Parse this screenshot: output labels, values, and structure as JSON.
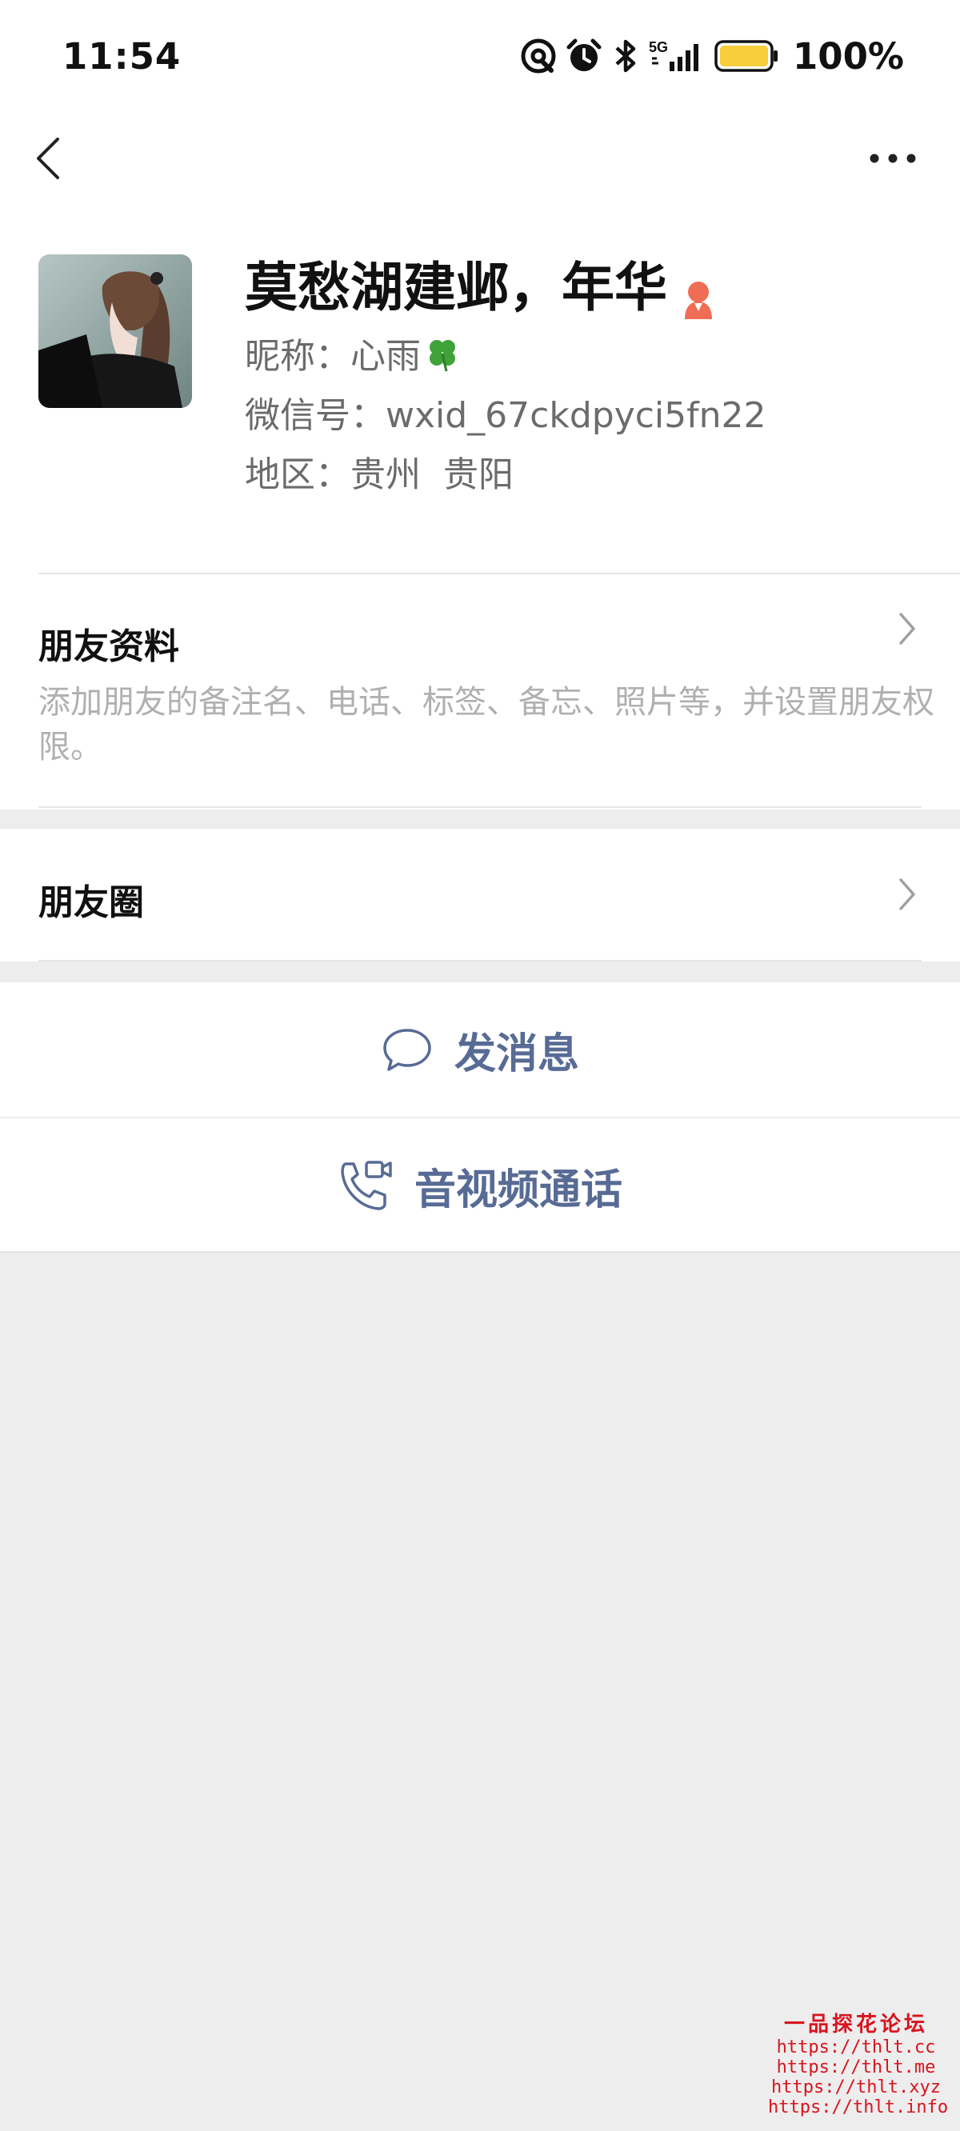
{
  "status_bar": {
    "time": "11:54",
    "network": "5G",
    "battery_percent": "100%",
    "icons": [
      "hotspot-icon",
      "alarm-icon",
      "bluetooth-icon",
      "signal-icon",
      "battery-icon"
    ]
  },
  "nav": {
    "back_icon": "chevron-left-icon",
    "more_icon": "more-dots-icon"
  },
  "profile": {
    "name": "莫愁湖建邺，年华",
    "gender_icon": "female-icon",
    "gender_color": "#f06d55",
    "nickname_label": "昵称：",
    "nickname_value": "心雨",
    "wechat_id_label": "微信号：",
    "wechat_id_value": "wxid_67ckdpyci5fn22",
    "region_label": "地区：",
    "region_value": "贵州  贵阳"
  },
  "rows": {
    "friend_info_title": "朋友资料",
    "friend_info_desc": "添加朋友的备注名、电话、标签、备忘、照片等，并设置朋友权限。",
    "moments_title": "朋友圈"
  },
  "actions": {
    "message_label": "发消息",
    "call_label": "音视频通话",
    "accent_color": "#576b95"
  },
  "watermark": {
    "title": "一品探花论坛",
    "links": [
      "https://thlt.cc",
      "https://thlt.me",
      "https://thlt.xyz",
      "https://thlt.info"
    ]
  }
}
